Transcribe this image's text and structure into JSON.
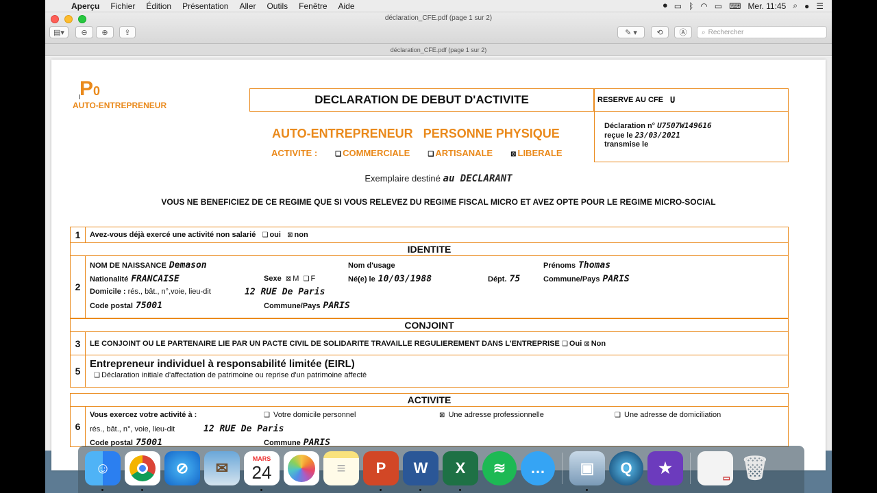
{
  "menubar": {
    "app": "Aperçu",
    "items": [
      "Fichier",
      "Édition",
      "Présentation",
      "Aller",
      "Outils",
      "Fenêtre",
      "Aide"
    ],
    "clock": "Mer. 11:45"
  },
  "window": {
    "title": "déclaration_CFE.pdf (page 1 sur 2)",
    "tab_title": "déclaration_CFE.pdf (page 1 sur 2)",
    "search_placeholder": "Rechercher"
  },
  "form": {
    "p0": "P",
    "p0_sub": "0",
    "auto_entrepreneur_small": "AUTO-ENTREPRENEUR",
    "title": "DECLARATION DE DEBUT D'ACTIVITE",
    "reserve_label": "RESERVE AU CFE",
    "reserve_value": "U",
    "declaration_label": "Déclaration n°",
    "declaration_value": "U7507W149616",
    "recue_label": "reçue le",
    "recue_value": "23/03/2021",
    "transmise_label": "transmise le",
    "ae_main": "AUTO-ENTREPRENEUR   PERSONNE PHYSIQUE",
    "activite_label": "ACTIVITE :",
    "activite_commerciale": "COMMERCIALE",
    "activite_artisanale": "ARTISANALE",
    "activite_liberale": "LIBERALE",
    "exemplaire_label": "Exemplaire destiné",
    "exemplaire_value": "au DECLARANT",
    "regime": "VOUS NE BENEFICIEZ DE CE REGIME QUE SI VOUS RELEVEZ DU REGIME FISCAL MICRO ET AVEZ OPTE POUR LE REGIME MICRO-SOCIAL",
    "q1_num": "1",
    "q1_text": "Avez-vous déjà exercé une activité non salarié",
    "q1_oui": "oui",
    "q1_non": "non",
    "section_identite": "IDENTITE",
    "q2_num": "2",
    "nom_naissance_label": "NOM DE NAISSANCE",
    "nom_naissance_value": "Demason",
    "nom_usage_label": "Nom d'usage",
    "prenoms_label": "Prénoms",
    "prenoms_value": "Thomas",
    "nationalite_label": "Nationalité",
    "nationalite_value": "FRANCAISE",
    "sexe_label": "Sexe",
    "sexe_m": "M",
    "sexe_f": "F",
    "nee_label": "Né(e) le",
    "nee_value": "10/03/1988",
    "dept_label": "Dépt.",
    "dept_value": "75",
    "commune_pays_label": "Commune/Pays",
    "commune_pays_value": "PARIS",
    "domicile_label": "Domicile :",
    "domicile_hint": "rés., bât., n°,voie, lieu-dit",
    "domicile_value": "12 RUE De Paris",
    "code_postal_label": "Code postal",
    "code_postal_value": "75001",
    "commune_pays2_label": "Commune/Pays",
    "commune_pays2_value": "PARIS",
    "section_conjoint": "CONJOINT",
    "q3_num": "3",
    "q3_text": "LE CONJOINT OU LE PARTENAIRE LIE PAR UN PACTE CIVIL DE SOLIDARITE TRAVAILLE REGULIEREMENT DANS L'ENTREPRISE",
    "q3_oui": "Oui",
    "q3_non": "Non",
    "q5_num": "5",
    "q5_title": "Entrepreneur individuel à responsabilité limitée (EIRL)",
    "q5_text": "Déclaration initiale d'affectation de patrimoine ou reprise d'un patrimoine affecté",
    "section_activite": "ACTIVITE",
    "q6_num": "6",
    "q6_label": "Vous exercez votre activité à :",
    "q6_opt1": "Votre domicile personnel",
    "q6_opt2": "Une adresse professionnelle",
    "q6_opt3": "Une adresse de domiciliation",
    "q6_addr_hint": "rés., bât., n°, voie, lieu-dit",
    "q6_addr_value": "12 RUE De Paris",
    "q6_cp_label": "Code postal",
    "q6_cp_value": "75001",
    "q6_commune_label": "Commune",
    "q6_commune_value": "PARIS"
  },
  "dock": {
    "calendar_month": "MARS",
    "calendar_day": "24",
    "apps": [
      "finder",
      "chrome",
      "safari",
      "mail",
      "calendar",
      "photos",
      "notes",
      "powerpoint",
      "word",
      "excel",
      "spotify",
      "messages",
      "preview",
      "quicktime",
      "imovie",
      "document",
      "trash"
    ]
  }
}
